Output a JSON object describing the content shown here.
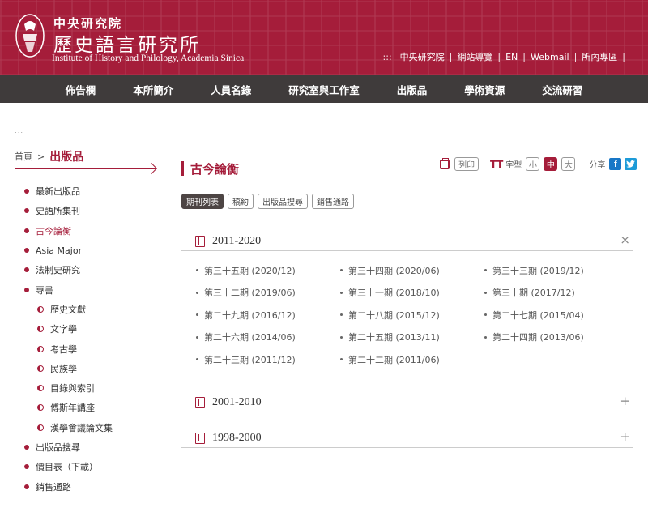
{
  "header": {
    "brand_zh_small": "中央研究院",
    "brand_zh_big": "歷史語言研究所",
    "brand_en": "Institute of History and Philology, Academia Sinica",
    "top_links": [
      "中央研究院",
      "網站導覽",
      "EN",
      "Webmail",
      "所內專區"
    ],
    "accent": "#a51d3a"
  },
  "nav": {
    "items": [
      "佈告欄",
      "本所簡介",
      "人員名錄",
      "研究室與工作室",
      "出版品",
      "學術資源",
      "交流研習"
    ]
  },
  "breadcrumb": {
    "home": "首頁",
    "sep": ">",
    "current": "出版品"
  },
  "sidebar": {
    "items": [
      {
        "label": "最新出版品"
      },
      {
        "label": "史語所集刊"
      },
      {
        "label": "古今論衡"
      },
      {
        "label": "Asia Major"
      },
      {
        "label": "法制史研究"
      },
      {
        "label": "專書"
      },
      {
        "label": "歷史文獻"
      },
      {
        "label": "文字學"
      },
      {
        "label": "考古學"
      },
      {
        "label": "民族學"
      },
      {
        "label": "目錄與索引"
      },
      {
        "label": "傅斯年講座"
      },
      {
        "label": "漢學會議論文集"
      },
      {
        "label": "出版品搜尋"
      },
      {
        "label": "價目表（下載）"
      },
      {
        "label": "銷售通路"
      }
    ]
  },
  "main": {
    "title": "古今論衡",
    "tools": {
      "print": "列印",
      "font_label": "字型",
      "font_small": "小",
      "font_mid": "中",
      "font_large": "大",
      "share": "分享"
    },
    "tabs": [
      "期刊列表",
      "稿約",
      "出版品搜尋",
      "銷售通路"
    ],
    "sections": [
      {
        "title": "2011-2020",
        "toggle": "×",
        "issues": [
          "第三十五期 (2020/12)",
          "第三十四期 (2020/06)",
          "第三十三期 (2019/12)",
          "第三十二期 (2019/06)",
          "第三十一期 (2018/10)",
          "第三十期 (2017/12)",
          "第二十九期 (2016/12)",
          "第二十八期 (2015/12)",
          "第二十七期 (2015/04)",
          "第二十六期 (2014/06)",
          "第二十五期 (2013/11)",
          "第二十四期 (2013/06)",
          "第二十三期 (2011/12)",
          "第二十二期 (2011/06)"
        ]
      },
      {
        "title": "2001-2010",
        "toggle": "+"
      },
      {
        "title": "1998-2000",
        "toggle": "+"
      }
    ]
  }
}
